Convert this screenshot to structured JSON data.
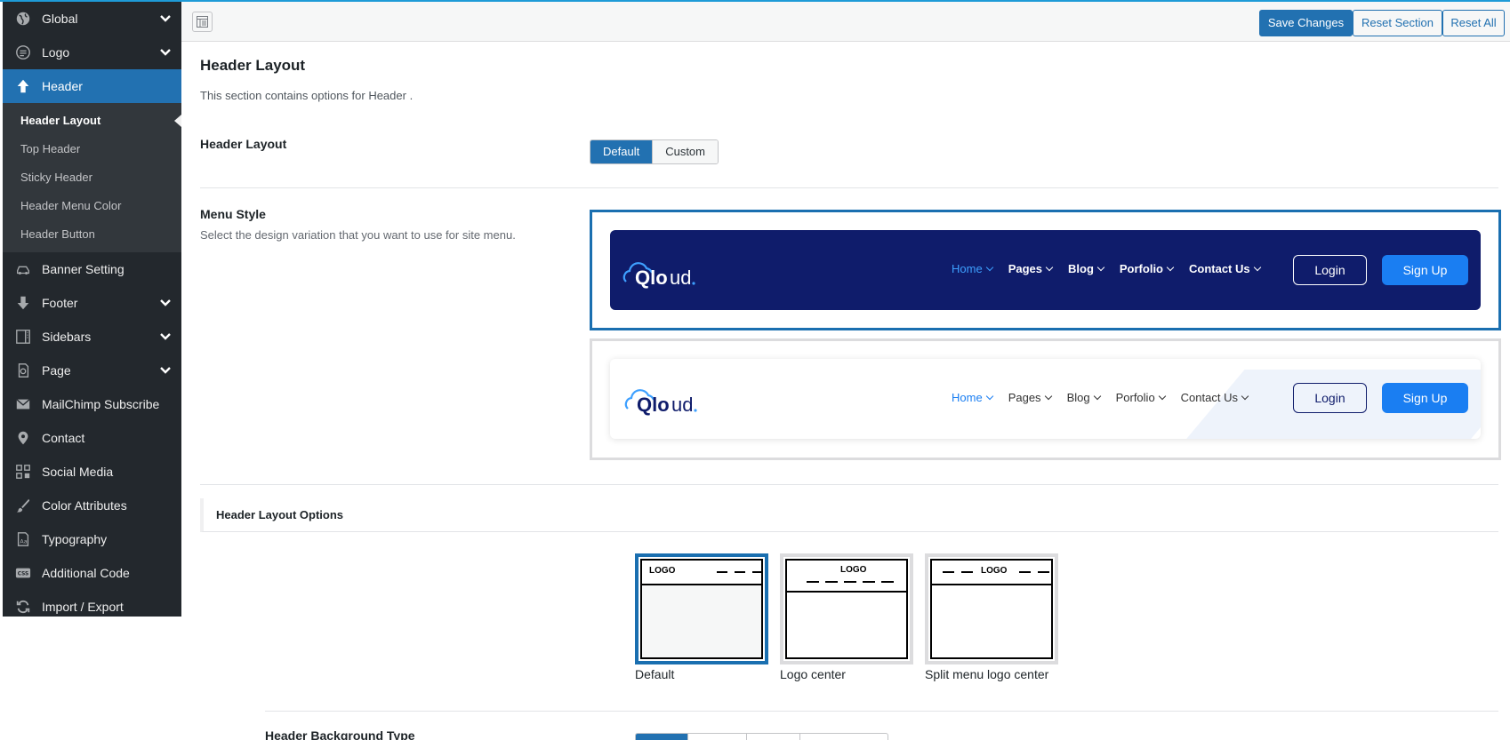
{
  "sidebar": {
    "items": [
      {
        "label": "Global",
        "icon": "globe-icon",
        "has_chevron": true
      },
      {
        "label": "Logo",
        "icon": "logo-icon",
        "has_chevron": true
      },
      {
        "label": "Header",
        "icon": "arrow-up-icon",
        "active": true
      },
      {
        "label": "Banner Setting",
        "icon": "car-icon"
      },
      {
        "label": "Footer",
        "icon": "arrow-down-icon",
        "has_chevron": true
      },
      {
        "label": "Sidebars",
        "icon": "columns-icon",
        "has_chevron": true
      },
      {
        "label": "Page",
        "icon": "page-icon",
        "has_chevron": true
      },
      {
        "label": "MailChimp Subscribe",
        "icon": "email-icon"
      },
      {
        "label": "Contact",
        "icon": "location-icon"
      },
      {
        "label": "Social Media",
        "icon": "share-icon"
      },
      {
        "label": "Color Attributes",
        "icon": "brush-icon"
      },
      {
        "label": "Typography",
        "icon": "font-icon"
      },
      {
        "label": "Additional Code",
        "icon": "css-icon"
      },
      {
        "label": "Import / Export",
        "icon": "sync-icon"
      }
    ],
    "header_submenu": [
      "Header Layout",
      "Top Header",
      "Sticky Header",
      "Header Menu Color",
      "Header Button"
    ],
    "active_submenu": "Header Layout"
  },
  "toolbar": {
    "save_label": "Save Changes",
    "reset_section_label": "Reset Section",
    "reset_all_label": "Reset All"
  },
  "section": {
    "title": "Header Layout",
    "description": "This section contains options for Header ."
  },
  "fields": {
    "header_layout": {
      "label": "Header Layout",
      "options": [
        "Default",
        "Custom"
      ],
      "selected": "Default"
    },
    "menu_style": {
      "label": "Menu Style",
      "description": "Select the design variation that you want to use for site menu.",
      "preview_logo": "Qloud",
      "preview_nav": [
        "Home",
        "Pages",
        "Blog",
        "Porfolio",
        "Contact Us"
      ],
      "preview_login": "Login",
      "preview_signup": "Sign Up"
    },
    "layout_options": {
      "heading": "Header Layout Options",
      "logo_text": "LOGO",
      "options": [
        "Default",
        "Logo center",
        "Split menu logo center"
      ],
      "selected": "Default"
    },
    "background_type": {
      "label": "Header Background Type"
    }
  },
  "colors": {
    "accent": "#2271b1",
    "sidebar_bg": "#23282d",
    "preview_dark_bg": "#0f1c6b",
    "preview_blue": "#1a7ef2"
  }
}
